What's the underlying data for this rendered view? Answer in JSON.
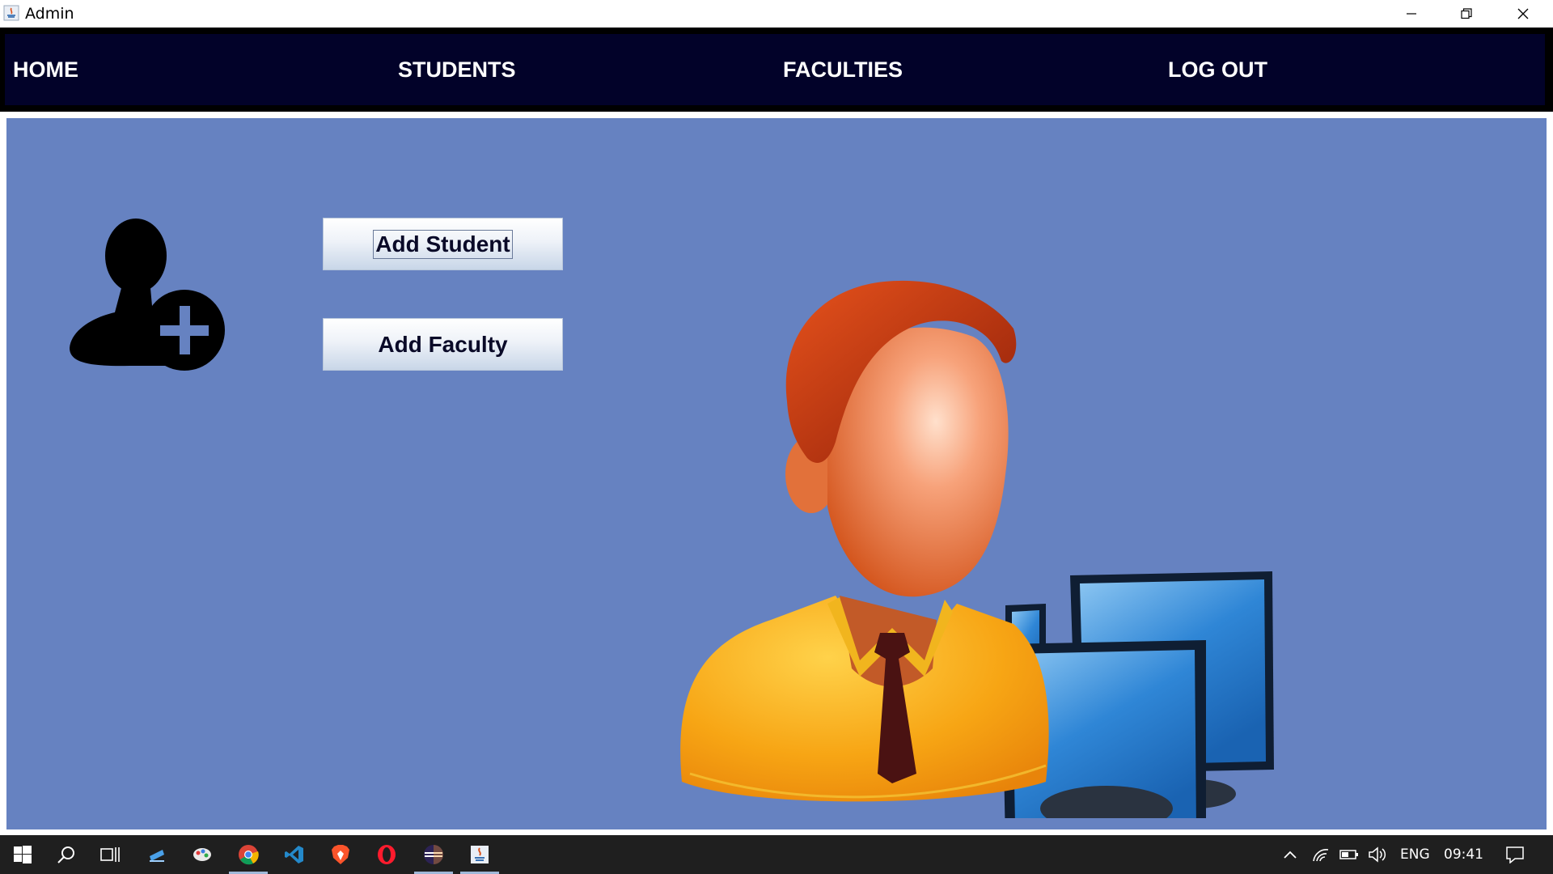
{
  "window": {
    "title": "Admin"
  },
  "nav": {
    "home": "HOME",
    "students": "STUDENTS",
    "faculties": "FACULTIES",
    "logout": "LOG OUT"
  },
  "actions": {
    "add_student": "Add Student",
    "add_faculty": "Add Faculty"
  },
  "icons": {
    "add_user": "add-user-icon",
    "illustration": "admin-with-computers-illustration"
  },
  "colors": {
    "nav_background": "#020229",
    "content_background": "#6682c1",
    "taskbar": "#1f1f1f"
  },
  "taskbar": {
    "apps": [
      "start",
      "search",
      "task-view",
      "app-1",
      "app-2",
      "chrome",
      "vscode",
      "brave",
      "opera",
      "eclipse",
      "java"
    ],
    "language": "ENG",
    "time": "09:41"
  }
}
